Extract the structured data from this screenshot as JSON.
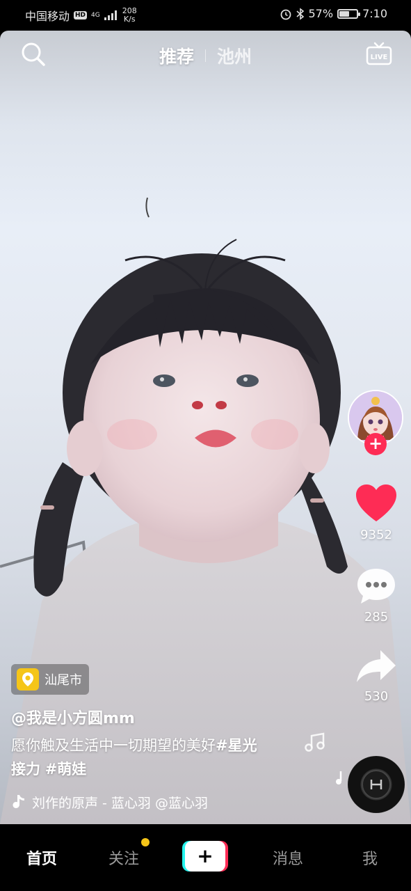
{
  "status_bar": {
    "carrier": "中国移动",
    "hd": "HD",
    "signal": "4G",
    "speed": "208",
    "speed_unit": "K/s",
    "battery": "57%",
    "battery_level": 0.57,
    "time": "7:10"
  },
  "top_nav": {
    "tab_active": "推荐",
    "tab_local": "池州",
    "live_label": "LIVE",
    "search_icon": "search-icon"
  },
  "rail": {
    "like_count": "9352",
    "comment_count": "285",
    "share_count": "530",
    "follow_label": "+"
  },
  "video": {
    "location": "汕尾市",
    "username": "@我是小方圆mm",
    "caption_text": "愿你触及生活中一切期望的美好",
    "caption_tag1": "#星光",
    "caption_tag1b": "接力",
    "caption_tag2": "#萌娃",
    "music": "刘作的原声 - 蓝心羽    @蓝心羽"
  },
  "bottom_tabs": {
    "home": "首页",
    "following": "关注",
    "create": "+",
    "messages": "消息",
    "me": "我"
  },
  "colors": {
    "accent": "#fe2c55",
    "badge": "#f5c518",
    "heart": "#fe2c55"
  }
}
